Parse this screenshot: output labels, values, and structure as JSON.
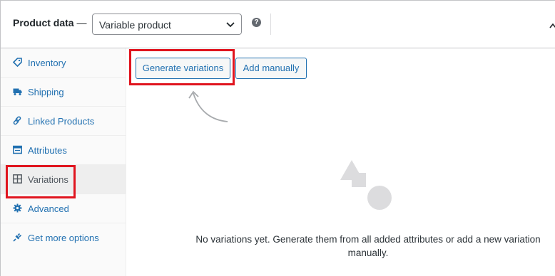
{
  "header": {
    "title": "Product data",
    "dash": "—",
    "product_type": "Variable product",
    "help_symbol": "?"
  },
  "sidebar": {
    "items": [
      {
        "label": "Inventory",
        "icon": "tag-icon"
      },
      {
        "label": "Shipping",
        "icon": "truck-icon"
      },
      {
        "label": "Linked Products",
        "icon": "link-icon"
      },
      {
        "label": "Attributes",
        "icon": "table-icon"
      },
      {
        "label": "Variations",
        "icon": "grid-icon",
        "active": true
      },
      {
        "label": "Advanced",
        "icon": "gear-icon"
      },
      {
        "label": "Get more options",
        "icon": "plugin-icon"
      }
    ]
  },
  "actions": {
    "generate_label": "Generate variations",
    "add_label": "Add manually"
  },
  "empty_state": {
    "message": "No variations yet. Generate them from all added attributes or add a new variation manually."
  },
  "colors": {
    "link": "#2271b1",
    "highlight": "#e0141e",
    "border": "#c3c4c7"
  }
}
